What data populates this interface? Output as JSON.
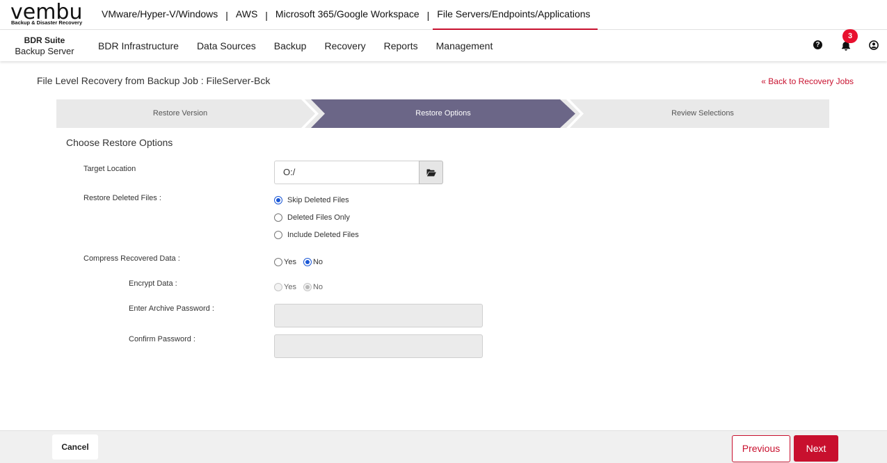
{
  "logo": {
    "wordmark": "vembu",
    "tagline": "Backup & Disaster Recovery"
  },
  "product_tabs": [
    {
      "label": "VMware/Hyper-V/Windows",
      "active": false
    },
    {
      "label": "AWS",
      "active": false
    },
    {
      "label": "Microsoft 365/Google Workspace",
      "active": false
    },
    {
      "label": "File Servers/Endpoints/Applications",
      "active": true
    }
  ],
  "product_separator": "|",
  "brand": {
    "line1": "BDR Suite",
    "line2": "Backup Server"
  },
  "menu": [
    "BDR Infrastructure",
    "Data Sources",
    "Backup",
    "Recovery",
    "Reports",
    "Management"
  ],
  "header_icons": {
    "help": "question-circle-icon",
    "notifications": "bell-icon",
    "user": "user-circle-icon",
    "notification_count": "3"
  },
  "page": {
    "title": "File Level Recovery from Backup Job : FileServer-Bck",
    "back_link": "« Back to Recovery Jobs"
  },
  "wizard": {
    "steps": [
      "Restore Version",
      "Restore Options",
      "Review Selections"
    ],
    "active_step": 1,
    "active_color": "#6b6687"
  },
  "form": {
    "section_title": "Choose Restore Options",
    "target_location": {
      "label": "Target Location",
      "value": "O:/",
      "browse_icon": "folder-open-icon"
    },
    "restore_deleted": {
      "label": "Restore Deleted Files :",
      "options": [
        "Skip Deleted Files",
        "Deleted Files Only",
        "Include Deleted Files"
      ],
      "selected": "Skip Deleted Files"
    },
    "compress": {
      "label": "Compress Recovered Data :",
      "yes": "Yes",
      "no": "No",
      "selected": "No"
    },
    "encrypt": {
      "label": "Encrypt Data :",
      "yes": "Yes",
      "no": "No",
      "selected": "No",
      "disabled": true
    },
    "archive_password": {
      "label": "Enter Archive Password :",
      "value": ""
    },
    "confirm_password": {
      "label": "Confirm Password :",
      "value": ""
    }
  },
  "footer": {
    "cancel": "Cancel",
    "previous": "Previous",
    "next": "Next"
  },
  "colors": {
    "accent": "#c8102e",
    "radio_selected": "#1a57d6"
  }
}
